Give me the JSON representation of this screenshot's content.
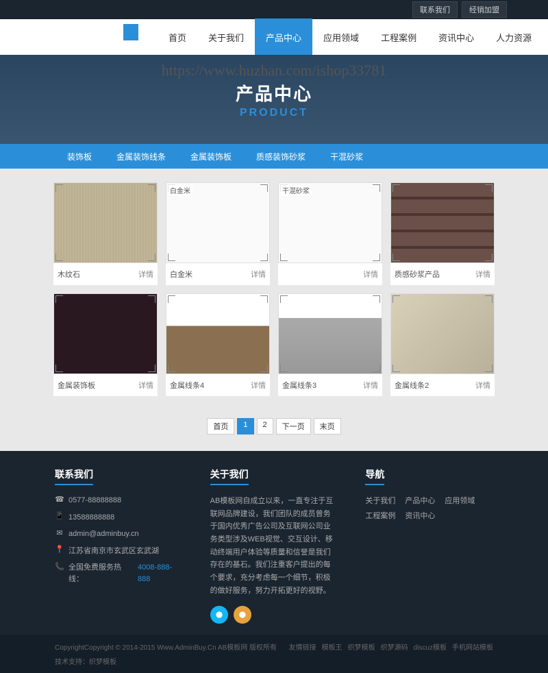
{
  "watermark": "https://www.huzhan.com/ishop33781",
  "topbar": {
    "contact": "联系我们",
    "franchise": "经销加盟"
  },
  "nav": {
    "items": [
      {
        "label": "首页"
      },
      {
        "label": "关于我们"
      },
      {
        "label": "产品中心"
      },
      {
        "label": "应用领域"
      },
      {
        "label": "工程案例"
      },
      {
        "label": "资讯中心"
      },
      {
        "label": "人力资源"
      }
    ]
  },
  "banner": {
    "title": "产品中心",
    "subtitle": "PRODUCT"
  },
  "categories": [
    {
      "label": "装饰板"
    },
    {
      "label": "金属装饰线条"
    },
    {
      "label": "金属装饰板"
    },
    {
      "label": "质感装饰砂浆"
    },
    {
      "label": "干混砂浆"
    }
  ],
  "products": [
    {
      "name": "木纹石",
      "detail": "详情",
      "img_label": "",
      "img_class": "wood"
    },
    {
      "name": "白金米",
      "detail": "详情",
      "img_label": "白金米",
      "img_class": "white"
    },
    {
      "name": "",
      "detail": "详情",
      "img_label": "干混砂浆",
      "img_class": "white"
    },
    {
      "name": "质感砂浆产品",
      "detail": "详情",
      "img_label": "",
      "img_class": "brick"
    },
    {
      "name": "金属装饰板",
      "detail": "详情",
      "img_label": "",
      "img_class": "marble"
    },
    {
      "name": "金属线条4",
      "detail": "详情",
      "img_label": "",
      "img_class": "strip"
    },
    {
      "name": "金属线条3",
      "detail": "详情",
      "img_label": "",
      "img_class": "strip2"
    },
    {
      "name": "金属线条2",
      "detail": "详情",
      "img_label": "",
      "img_class": "strip3"
    }
  ],
  "pagination": {
    "first": "首页",
    "p1": "1",
    "p2": "2",
    "next": "下一页",
    "last": "末页"
  },
  "footer": {
    "contact": {
      "title": "联系我们",
      "tel": "0577-88888888",
      "mobile": "13588888888",
      "email": "admin@adminbuy.cn",
      "address": "江苏省南京市玄武区玄武湖",
      "hotline_label": "全国免费服务热线：",
      "hotline": "4008-888-888"
    },
    "about": {
      "title": "关于我们",
      "text": "AB模板网自成立以来，一直专注于互联网品牌建设，我们团队的成员曾务于国内优秀广告公司及互联网公司业务类型涉及WEB视觉、交互设计、移动终端用户体验等质量和信誉是我们存在的基石。我们注重客户提出的每个要求，充分考虑每一个细节，积极的做好服务，努力开拓更好的视野。"
    },
    "navigation": {
      "title": "导航",
      "links": [
        "关于我们",
        "产品中心",
        "应用领域",
        "工程案例",
        "资讯中心"
      ]
    }
  },
  "copyright": {
    "text": "CopyrightCopyright © 2014-2015 Www.AdminBuy.Cn AB模板网 版权所有",
    "friendlinks_label": "友情链接",
    "friendlinks": [
      "模板王",
      "织梦模板",
      "织梦源码",
      "discuz模板",
      "手机网站模板"
    ],
    "support_label": "技术支持：",
    "support": "织梦模板"
  }
}
